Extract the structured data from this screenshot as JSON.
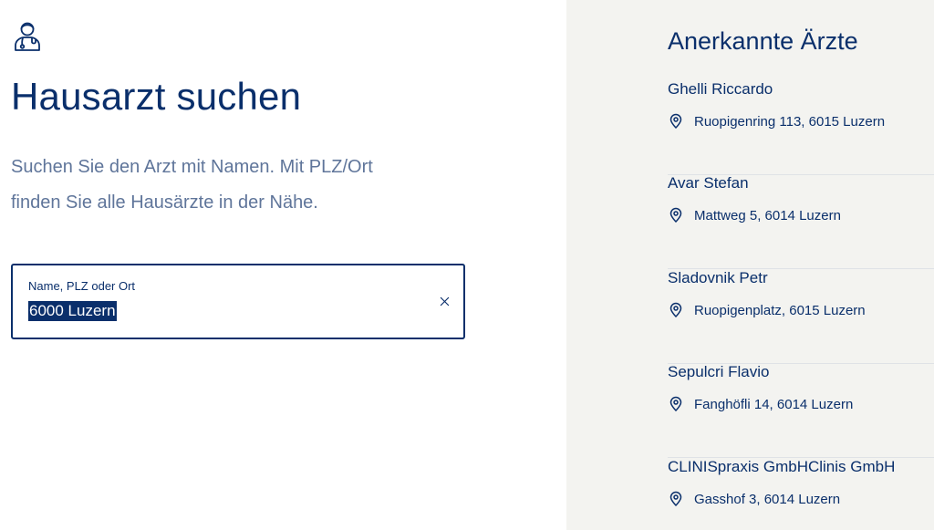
{
  "main": {
    "title": "Hausarzt suchen",
    "subtitle_line1": "Suchen Sie den Arzt mit Namen. Mit PLZ/Ort",
    "subtitle_line2": "finden Sie alle Hausärzte in der Nähe.",
    "icon": "doctor-icon"
  },
  "search": {
    "label": "Name, PLZ oder Ort",
    "value": "6000 Luzern",
    "clear_icon": "close-icon",
    "value_selected": true
  },
  "results": {
    "title": "Anerkannte Ärzte",
    "items": [
      {
        "name": "Ghelli Riccardo",
        "address": "Ruopigenring 113, 6015 Luzern"
      },
      {
        "name": "Avar Stefan",
        "address": "Mattweg 5, 6014 Luzern"
      },
      {
        "name": "Sladovnik Petr",
        "address": "Ruopigenplatz, 6015 Luzern"
      },
      {
        "name": "Sepulcri Flavio",
        "address": "Fanghöfli 14, 6014 Luzern"
      },
      {
        "name": "CLINISpraxis GmbHClinis GmbH",
        "address": "Gasshof 3, 6014 Luzern"
      }
    ]
  },
  "colors": {
    "brand": "#0a2f6b",
    "muted_text": "#5f759a",
    "sidebar_bg": "#f3f3f0"
  }
}
